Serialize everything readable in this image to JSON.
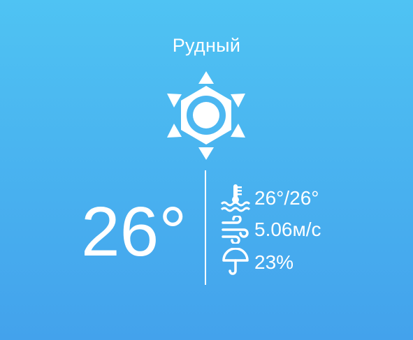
{
  "weather": {
    "city": "Рудный",
    "condition_icon": "sun-icon",
    "temperature": "26",
    "degree": "°",
    "feels_like": "26°/26°",
    "wind": "5.06м/с",
    "precipitation": "23%"
  },
  "colors": {
    "background_top": "#4fc3f3",
    "background_bottom": "#43a2ec",
    "text": "#ffffff"
  },
  "icons": {
    "feels_like": "water-temperature-icon",
    "wind": "wind-icon",
    "precipitation": "umbrella-icon"
  }
}
